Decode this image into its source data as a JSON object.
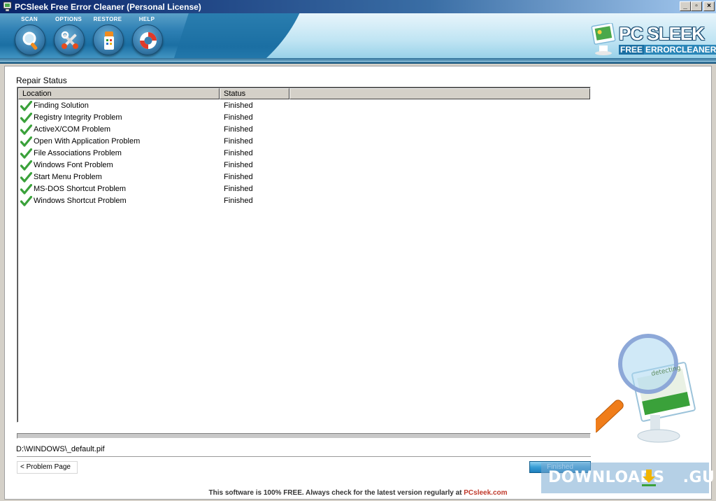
{
  "window": {
    "title": "PCSleek Free Error Cleaner (Personal License)",
    "controls": {
      "minimize": "_",
      "maximize": "▫",
      "close": "×"
    }
  },
  "toolbar": {
    "items": [
      {
        "label": "SCAN",
        "icon": "magnifier-icon"
      },
      {
        "label": "OPTIONS",
        "icon": "tools-icon"
      },
      {
        "label": "RESTORE",
        "icon": "restore-icon"
      },
      {
        "label": "HELP",
        "icon": "lifebuoy-icon"
      }
    ]
  },
  "logo": {
    "brand": "PC SLEEK",
    "free": "FREE",
    "product": "ERRORCLEANER"
  },
  "repair": {
    "title": "Repair Status",
    "columns": [
      "Location",
      "Status"
    ],
    "rows": [
      {
        "location": "Finding Solution",
        "status": "Finished"
      },
      {
        "location": "Registry Integrity Problem",
        "status": "Finished"
      },
      {
        "location": "ActiveX/COM Problem",
        "status": "Finished"
      },
      {
        "location": "Open With Application Problem",
        "status": "Finished"
      },
      {
        "location": "File Associations Problem",
        "status": "Finished"
      },
      {
        "location": "Windows Font Problem",
        "status": "Finished"
      },
      {
        "location": "Start Menu Problem",
        "status": "Finished"
      },
      {
        "location": "MS-DOS Shortcut Problem",
        "status": "Finished"
      },
      {
        "location": "Windows Shortcut Problem",
        "status": "Finished"
      }
    ]
  },
  "current_file": "D:\\WINDOWS\\_default.pif",
  "buttons": {
    "problem_page": "< Problem Page",
    "finished": "Finished"
  },
  "footer": {
    "text": "This software is 100% FREE. Always check for the latest version regularly at ",
    "site": "PCsleek.com"
  },
  "illustration": {
    "screen_text": "detecting"
  },
  "watermark": {
    "text": "DOWNLOADS",
    "suffix": ".GURU"
  },
  "colors": {
    "accent": "#1b6fa3",
    "check": "#3aa13a",
    "footer_link": "#c0392b"
  }
}
